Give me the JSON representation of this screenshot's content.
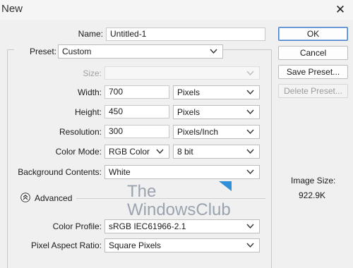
{
  "window": {
    "title": "New"
  },
  "form": {
    "name": {
      "label": "Name:",
      "value": "Untitled-1"
    },
    "preset": {
      "label": "Preset:",
      "value": "Custom"
    },
    "size": {
      "label": "Size:",
      "value": ""
    },
    "width": {
      "label": "Width:",
      "value": "700",
      "unit": "Pixels"
    },
    "height": {
      "label": "Height:",
      "value": "450",
      "unit": "Pixels"
    },
    "resolution": {
      "label": "Resolution:",
      "value": "300",
      "unit": "Pixels/Inch"
    },
    "color_mode": {
      "label": "Color Mode:",
      "value": "RGB Color",
      "depth": "8 bit"
    },
    "background": {
      "label": "Background Contents:",
      "value": "White"
    },
    "advanced": {
      "label": "Advanced"
    },
    "color_profile": {
      "label": "Color Profile:",
      "value": "sRGB IEC61966-2.1"
    },
    "pixel_aspect": {
      "label": "Pixel Aspect Ratio:",
      "value": "Square Pixels"
    }
  },
  "buttons": {
    "ok": "OK",
    "cancel": "Cancel",
    "save_preset": "Save Preset...",
    "delete_preset": "Delete Preset..."
  },
  "image_size": {
    "label": "Image Size:",
    "value": "922.9K"
  },
  "watermark": {
    "line1": "The",
    "line2": "WindowsClub"
  },
  "colors": {
    "accent": "#4b7fc6",
    "watermark_blue": "#2f8fd8"
  }
}
